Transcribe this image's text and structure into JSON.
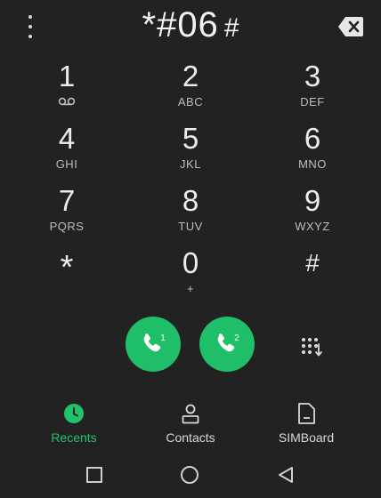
{
  "dialer": {
    "number_main": "*#06",
    "number_tail": "#"
  },
  "keys": [
    {
      "digit": "1",
      "sub": ""
    },
    {
      "digit": "2",
      "sub": "ABC"
    },
    {
      "digit": "3",
      "sub": "DEF"
    },
    {
      "digit": "4",
      "sub": "GHI"
    },
    {
      "digit": "5",
      "sub": "JKL"
    },
    {
      "digit": "6",
      "sub": "MNO"
    },
    {
      "digit": "7",
      "sub": "PQRS"
    },
    {
      "digit": "8",
      "sub": "TUV"
    },
    {
      "digit": "9",
      "sub": "WXYZ"
    },
    {
      "digit": "*",
      "sub": ""
    },
    {
      "digit": "0",
      "sub": "+"
    },
    {
      "digit": "#",
      "sub": ""
    }
  ],
  "call_buttons": [
    {
      "sim": "1"
    },
    {
      "sim": "2"
    }
  ],
  "tabs": [
    {
      "label": "Recents",
      "icon": "clock-icon",
      "active": true
    },
    {
      "label": "Contacts",
      "icon": "person-icon",
      "active": false
    },
    {
      "label": "SIMBoard",
      "icon": "sim-card-icon",
      "active": false
    }
  ],
  "colors": {
    "background": "#222222",
    "accent": "#22c26b",
    "call_button": "#1fbf6a"
  }
}
